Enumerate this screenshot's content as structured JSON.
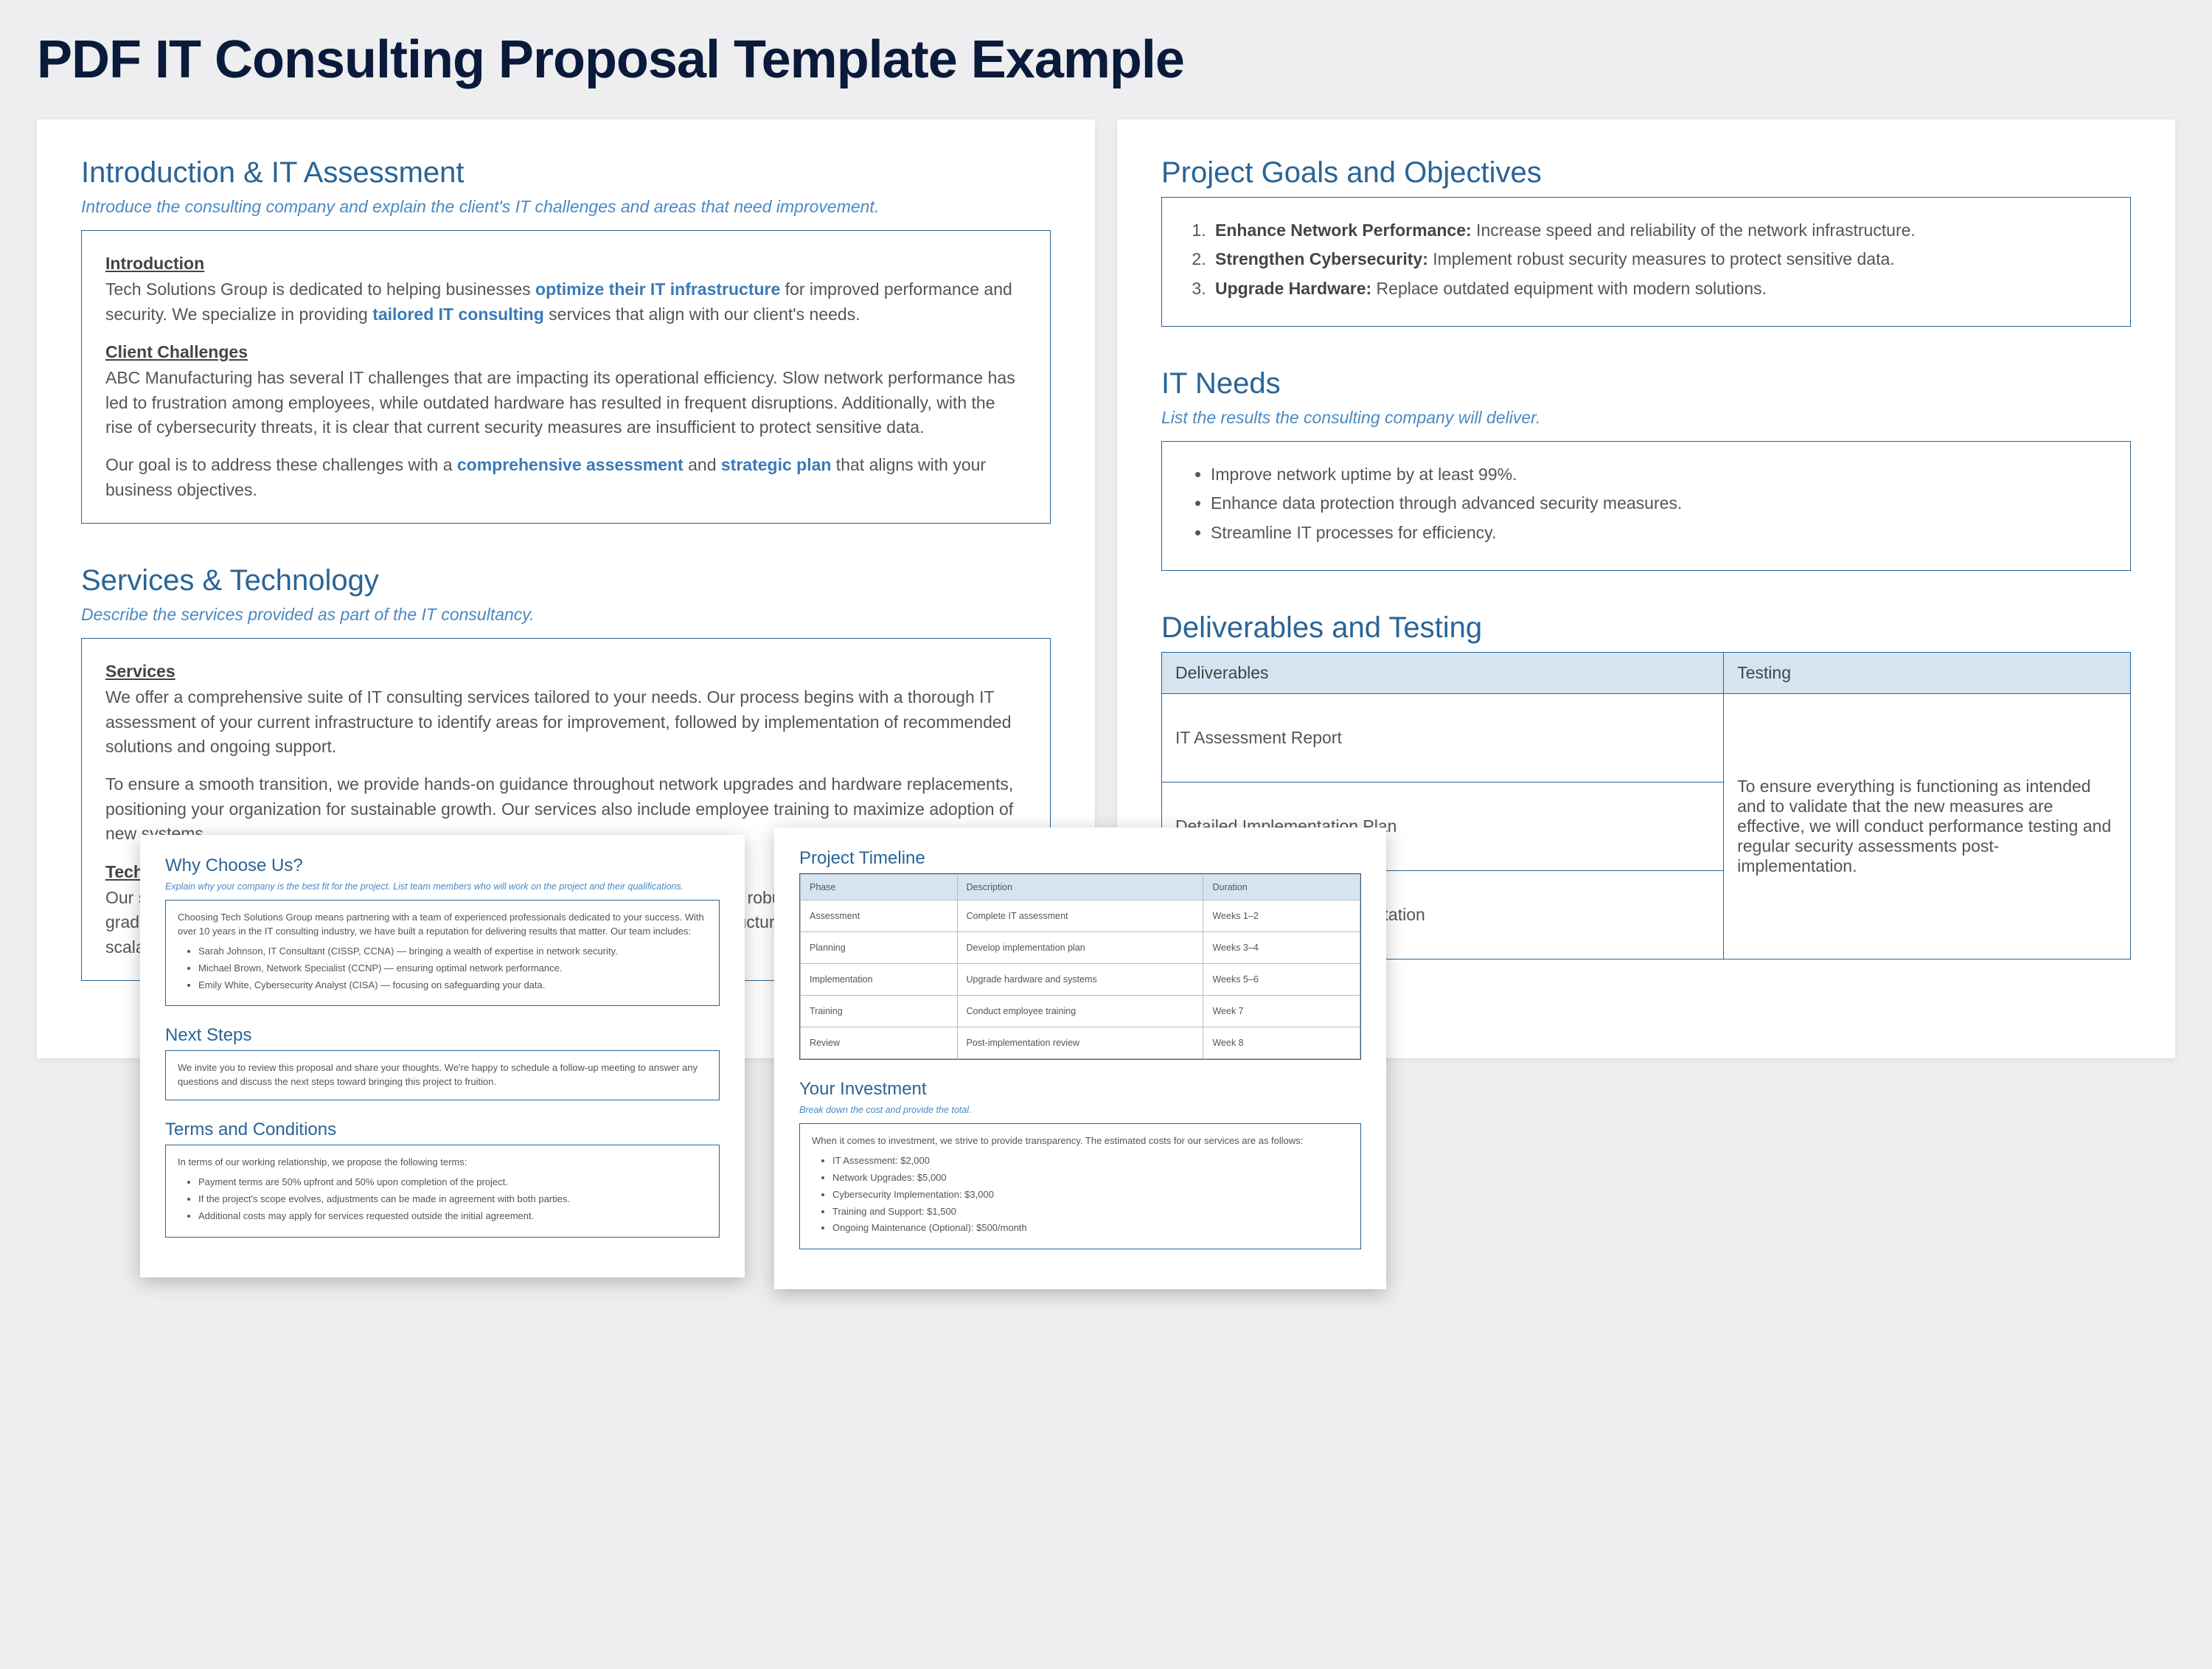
{
  "title": "PDF IT Consulting Proposal Template Example",
  "intro": {
    "heading": "Introduction & IT Assessment",
    "sub": "Introduce the consulting company and explain the client's IT challenges and areas that need improvement.",
    "h1": "Introduction",
    "p1a": "Tech Solutions Group is dedicated to helping businesses ",
    "p1b": "optimize their IT infrastructure",
    "p1c": " for improved performance and security. We specialize in providing ",
    "p1d": "tailored IT consulting",
    "p1e": " services that align with our client's needs.",
    "h2": "Client Challenges",
    "p2": "ABC Manufacturing has several IT challenges that are impacting its operational efficiency. Slow network performance has led to frustration among employees, while outdated hardware has resulted in frequent disruptions. Additionally, with the rise of cybersecurity threats, it is clear that current security measures are insufficient to protect sensitive data.",
    "p3a": "Our goal is to address these challenges with a ",
    "p3b": "comprehensive assessment",
    "p3c": " and ",
    "p3d": "strategic plan",
    "p3e": " that aligns with your business objectives."
  },
  "services": {
    "heading": "Services & Technology",
    "sub": "Describe the services provided as part of the IT consultancy.",
    "h1": "Services",
    "p1": "We offer a comprehensive suite of IT consulting services tailored to your needs. Our process begins with a thorough IT assessment of your current infrastructure to identify areas for improvement, followed by implementation of recommended solutions and ongoing support.",
    "p2": "To ensure a smooth transition, we provide hands-on guidance throughout network upgrades and hardware replacements, positioning your organization for sustainable growth. Our services also include employee training to maximize adoption of new systems.",
    "h2": "Technology",
    "p3": "Our solutions leverage industry-leading tools — from Cisco networking equipment for robust connectivity to enterprise-grade security platforms and Microsoft 365 for collaboration — ensuring your infrastructure is modern, secure, and scalable."
  },
  "goals": {
    "heading": "Project Goals and Objectives",
    "items": [
      {
        "b": "Enhance Network Performance:",
        "t": " Increase speed and reliability of the network infrastructure."
      },
      {
        "b": "Strengthen Cybersecurity:",
        "t": " Implement robust security measures to protect sensitive data."
      },
      {
        "b": "Upgrade Hardware:",
        "t": " Replace outdated equipment with modern solutions."
      }
    ]
  },
  "needs": {
    "heading": "IT Needs",
    "sub": "List the results the consulting company will deliver.",
    "items": [
      "Improve network uptime by at least 99%.",
      "Enhance data protection through advanced security measures.",
      "Streamline IT processes for efficiency."
    ]
  },
  "deliv": {
    "heading": "Deliverables and Testing",
    "col_deliv": "Deliverables",
    "col_test": "Testing",
    "rows": [
      "IT Assessment Report",
      "Detailed Implementation Plan",
      "Updated Network Documentation"
    ],
    "testing": "To ensure everything is functioning as intended and to validate that the new measures are effective, we will conduct performance testing and regular security assessments post-implementation."
  },
  "why": {
    "heading": "Why Choose Us?",
    "sub": "Explain why your company is the best fit for the project. List team members who will work on the project and their qualifications.",
    "intro": "Choosing Tech Solutions Group means partnering with a team of experienced professionals dedicated to your success. With over 10 years in the IT consulting industry, we have built a reputation for delivering results that matter. Our team includes:",
    "team": [
      "Sarah Johnson, IT Consultant (CISSP, CCNA) — bringing a wealth of expertise in network security.",
      "Michael Brown, Network Specialist (CCNP) — ensuring optimal network performance.",
      "Emily White, Cybersecurity Analyst (CISA) — focusing on safeguarding your data."
    ]
  },
  "next": {
    "heading": "Next Steps",
    "body": "We invite you to review this proposal and share your thoughts. We're happy to schedule a follow-up meeting to answer any questions and discuss the next steps toward bringing this project to fruition."
  },
  "terms": {
    "heading": "Terms and Conditions",
    "intro": "In terms of our working relationship, we propose the following terms:",
    "items": [
      "Payment terms are 50% upfront and 50% upon completion of the project.",
      "If the project's scope evolves, adjustments can be made in agreement with both parties.",
      "Additional costs may apply for services requested outside the initial agreement."
    ]
  },
  "timeline": {
    "heading": "Project Timeline",
    "cols": [
      "Phase",
      "Description",
      "Duration"
    ],
    "rows": [
      [
        "Assessment",
        "Complete IT assessment",
        "Weeks 1–2"
      ],
      [
        "Planning",
        "Develop implementation plan",
        "Weeks 3–4"
      ],
      [
        "Implementation",
        "Upgrade hardware and systems",
        "Weeks 5–6"
      ],
      [
        "Training",
        "Conduct employee training",
        "Week 7"
      ],
      [
        "Review",
        "Post-implementation review",
        "Week 8"
      ]
    ]
  },
  "invest": {
    "heading": "Your Investment",
    "sub": "Break down the cost and provide the total.",
    "intro": "When it comes to investment, we strive to provide transparency. The estimated costs for our services are as follows:",
    "items": [
      "IT Assessment: $2,000",
      "Network Upgrades: $5,000",
      "Cybersecurity Implementation: $3,000",
      "Training and Support: $1,500",
      "Ongoing Maintenance (Optional): $500/month"
    ]
  }
}
